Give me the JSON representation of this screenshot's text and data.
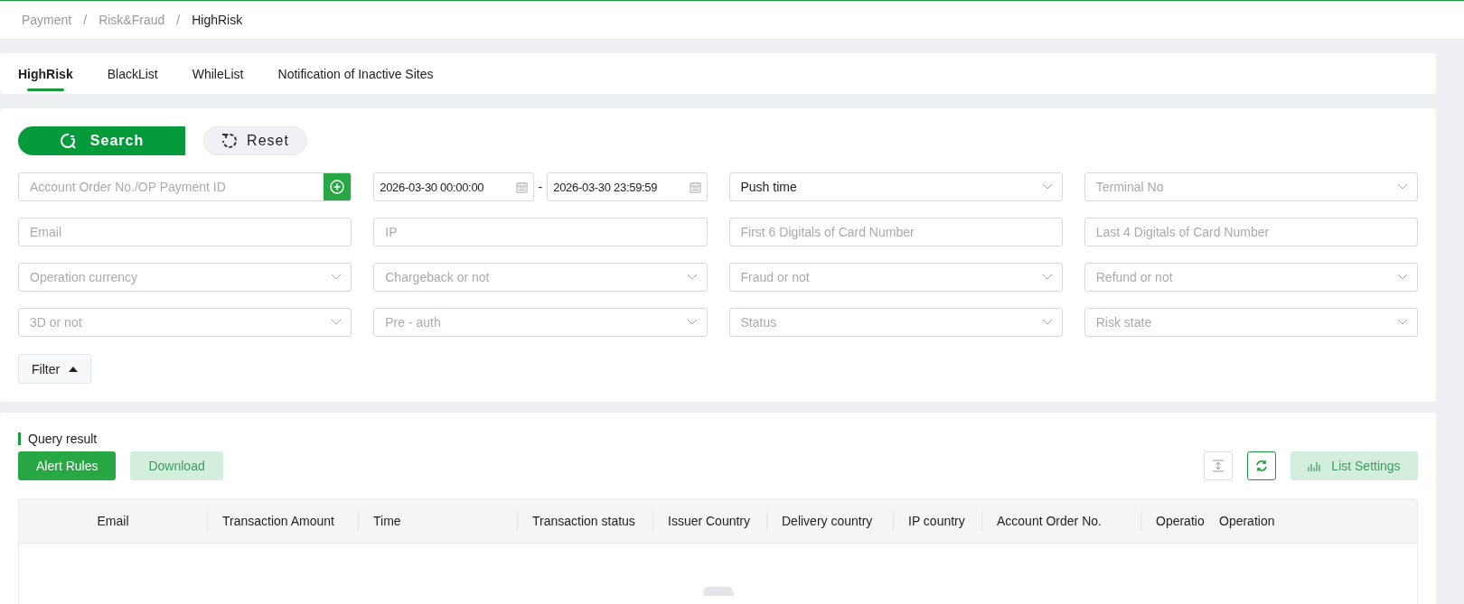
{
  "breadcrumb": [
    {
      "kind": "link",
      "label": "Payment",
      "current": false
    },
    {
      "label": "/",
      "kind": "sep"
    },
    {
      "kind": "link",
      "label": "Risk&Fraud",
      "current": false
    },
    {
      "label": "/",
      "kind": "sep"
    },
    {
      "kind": "link",
      "label": "HighRisk",
      "current": true
    }
  ],
  "tabs": [
    {
      "label": "HighRisk",
      "selected": true
    },
    {
      "label": "BlackList",
      "selected": false
    },
    {
      "label": "WhileList",
      "selected": false
    },
    {
      "label": "Notification of Inactive Sites",
      "selected": false
    }
  ],
  "actions": {
    "search": "Search",
    "reset": "Reset"
  },
  "filters": [
    {
      "kind": "input-add",
      "placeholder": "Account Order No./OP Payment ID"
    },
    {
      "kind": "daterange",
      "start": "2026-03-30 00:00:00",
      "separator": "-",
      "end": "2026-03-30 23:59:59"
    },
    {
      "kind": "select",
      "value": "Push time"
    },
    {
      "kind": "select",
      "placeholder": "Terminal No"
    },
    {
      "kind": "input",
      "placeholder": "Email"
    },
    {
      "kind": "input",
      "placeholder": "IP"
    },
    {
      "kind": "input",
      "placeholder": "First 6 Digitals of Card Number"
    },
    {
      "kind": "input",
      "placeholder": "Last 4 Digitals of Card Number"
    },
    {
      "kind": "select",
      "placeholder": "Operation currency"
    },
    {
      "kind": "select",
      "placeholder": "Chargeback or not"
    },
    {
      "kind": "select",
      "placeholder": "Fraud or not"
    },
    {
      "kind": "select",
      "placeholder": "Refund or not"
    },
    {
      "kind": "select",
      "placeholder": "3D or not"
    },
    {
      "kind": "select",
      "placeholder": "Pre - auth"
    },
    {
      "kind": "select",
      "placeholder": "Status"
    },
    {
      "kind": "select",
      "placeholder": "Risk state"
    }
  ],
  "filter_toggle": {
    "label": "Filter",
    "expanded": true
  },
  "results": {
    "title": "Query result",
    "buttons": [
      {
        "label": "Alert Rules",
        "disabled": false
      },
      {
        "label": "Download",
        "disabled": true
      }
    ],
    "list_settings": {
      "label": "List Settings",
      "disabled": true
    },
    "columns": [
      {
        "label": "Email"
      },
      {
        "label": "Transaction Amount"
      },
      {
        "label": "Time"
      },
      {
        "label": "Transaction status"
      },
      {
        "label": "Issuer Country"
      },
      {
        "label": "Delivery country"
      },
      {
        "label": "IP country"
      },
      {
        "label": "Account Order No."
      },
      {
        "label": "Operatio"
      },
      {
        "label": "Operation"
      }
    ]
  }
}
